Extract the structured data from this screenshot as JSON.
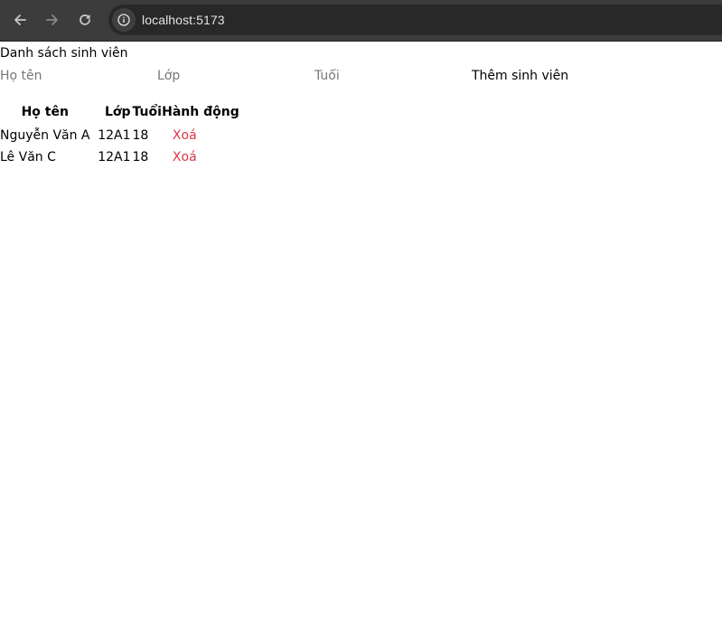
{
  "browser": {
    "url": "localhost:5173"
  },
  "page": {
    "title": "Danh sách sinh viên"
  },
  "form": {
    "name_placeholder": "Họ tên",
    "class_placeholder": "Lớp",
    "age_placeholder": "Tuổi",
    "add_label": "Thêm sinh viên"
  },
  "table": {
    "headers": {
      "name": "Họ tên",
      "class": "Lớp",
      "age": "Tuổi",
      "action": "Hành động"
    },
    "rows": [
      {
        "name": "Nguyễn Văn A",
        "class": "12A1",
        "age": "18",
        "action": "Xoá"
      },
      {
        "name": "Lê Văn C",
        "class": "12A1",
        "age": "18",
        "action": "Xoá"
      }
    ]
  },
  "colors": {
    "delete": "#dc3545",
    "chrome_bg": "#3c3c3c",
    "omnibox_bg": "#282828"
  },
  "icons": {
    "back": "arrow-left-icon",
    "forward": "arrow-right-icon",
    "reload": "reload-icon",
    "site_info": "info-icon"
  }
}
